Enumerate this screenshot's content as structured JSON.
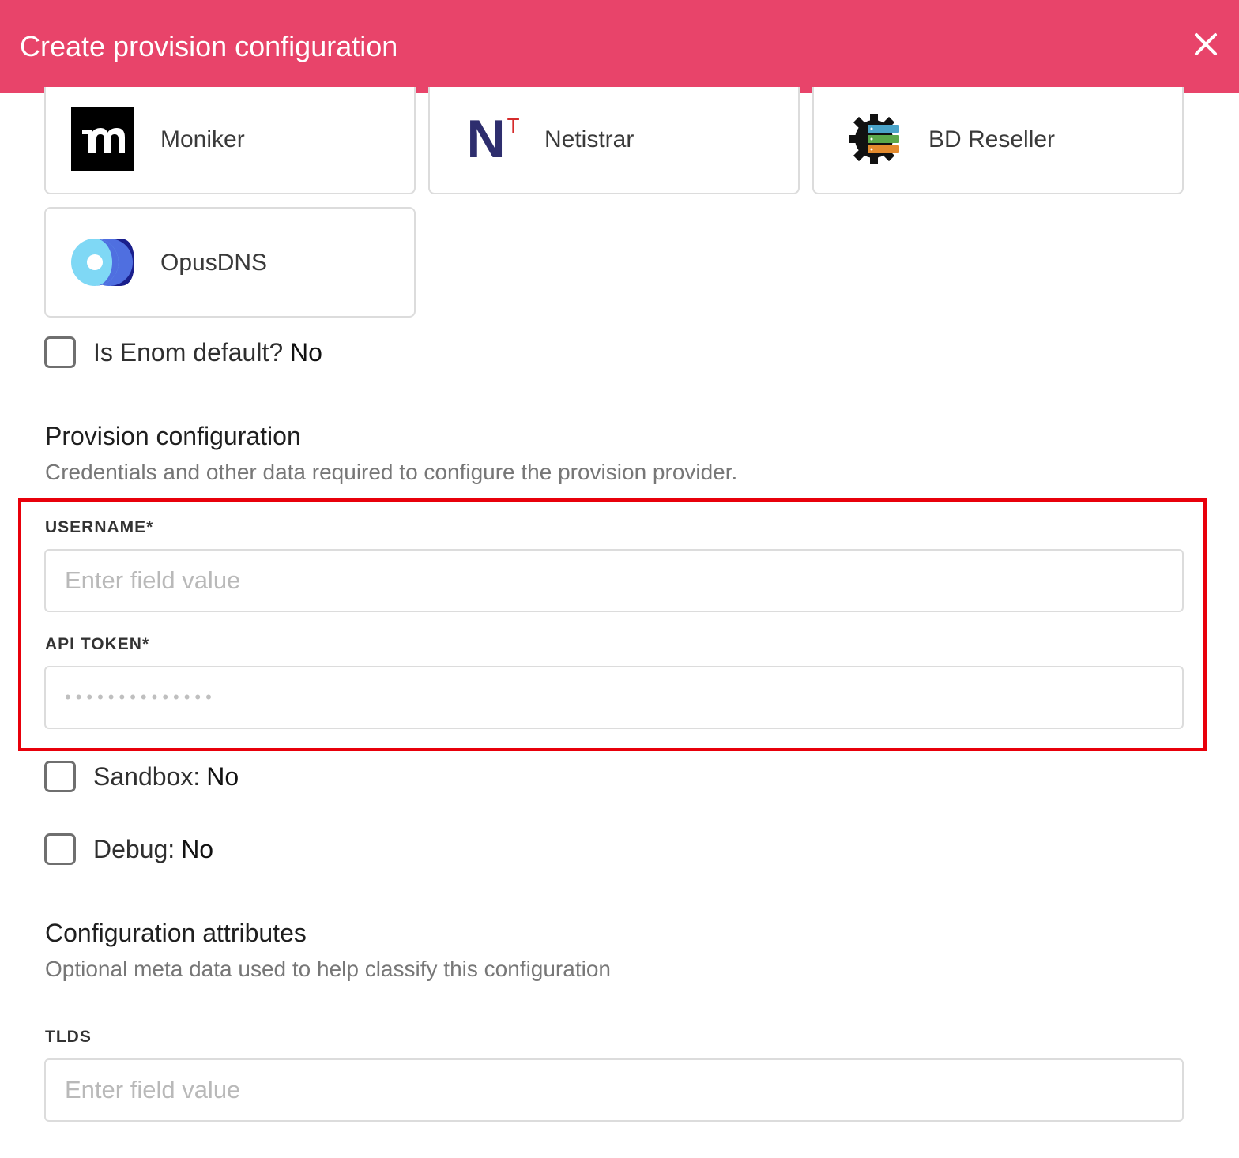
{
  "header": {
    "title": "Create provision configuration",
    "close_icon": "close-icon"
  },
  "providers": [
    {
      "name": "Moniker",
      "icon": "moniker-logo-icon"
    },
    {
      "name": "Netistrar",
      "icon": "netistrar-logo-icon",
      "logo_text": "N",
      "logo_sup": "T"
    },
    {
      "name": "BD Reseller",
      "icon": "bd-reseller-gear-icon"
    },
    {
      "name": "OpusDNS",
      "icon": "opusdns-logo-icon"
    }
  ],
  "enom_default": {
    "prefix": "Is",
    "keyword": "Enom",
    "suffix": "default?",
    "value": "No"
  },
  "provision": {
    "title": "Provision configuration",
    "description": "Credentials and other data required to configure the provision provider.",
    "username": {
      "label": "USERNAME*",
      "placeholder": "Enter field value",
      "value": ""
    },
    "api_token": {
      "label": "API TOKEN*",
      "masked_value": "••••••••••••••"
    }
  },
  "sandbox": {
    "label": "Sandbox:",
    "value": "No"
  },
  "debug": {
    "label": "Debug:",
    "value": "No"
  },
  "attributes": {
    "title": "Configuration attributes",
    "description": "Optional meta data used to help classify this configuration",
    "tlds": {
      "label": "TLDS",
      "placeholder": "Enter field value"
    }
  },
  "colors": {
    "header": "#e8446a",
    "highlight": "#e8000b",
    "netistrar_navy": "#2e2e6e",
    "netistrar_red": "#d52b2b"
  }
}
